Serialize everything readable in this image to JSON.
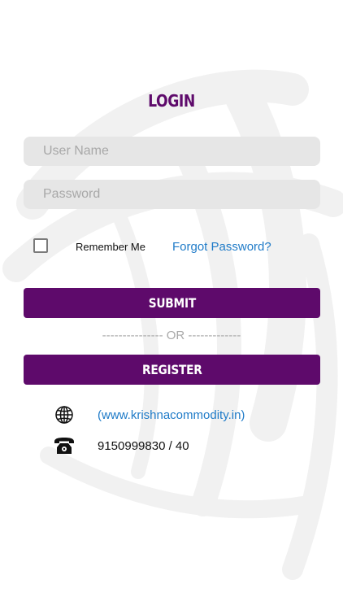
{
  "login": {
    "title": "LOGIN",
    "username_placeholder": "User Name",
    "password_placeholder": "Password",
    "remember_label": "Remember Me",
    "remember_checked": false,
    "forgot_label": "Forgot Password?",
    "submit_label": "SUBMIT",
    "or_divider": "--------------- OR -------------",
    "register_label": "REGISTER"
  },
  "contact": {
    "website_icon": "globe-icon",
    "website": "(www.krishnacommodity.in)",
    "phone_icon": "telephone-icon",
    "phone": "9150999830 / 40"
  },
  "colors": {
    "brand": "#5e0a6b",
    "link": "#1f7bc8",
    "field_bg": "#e6e6e6"
  }
}
